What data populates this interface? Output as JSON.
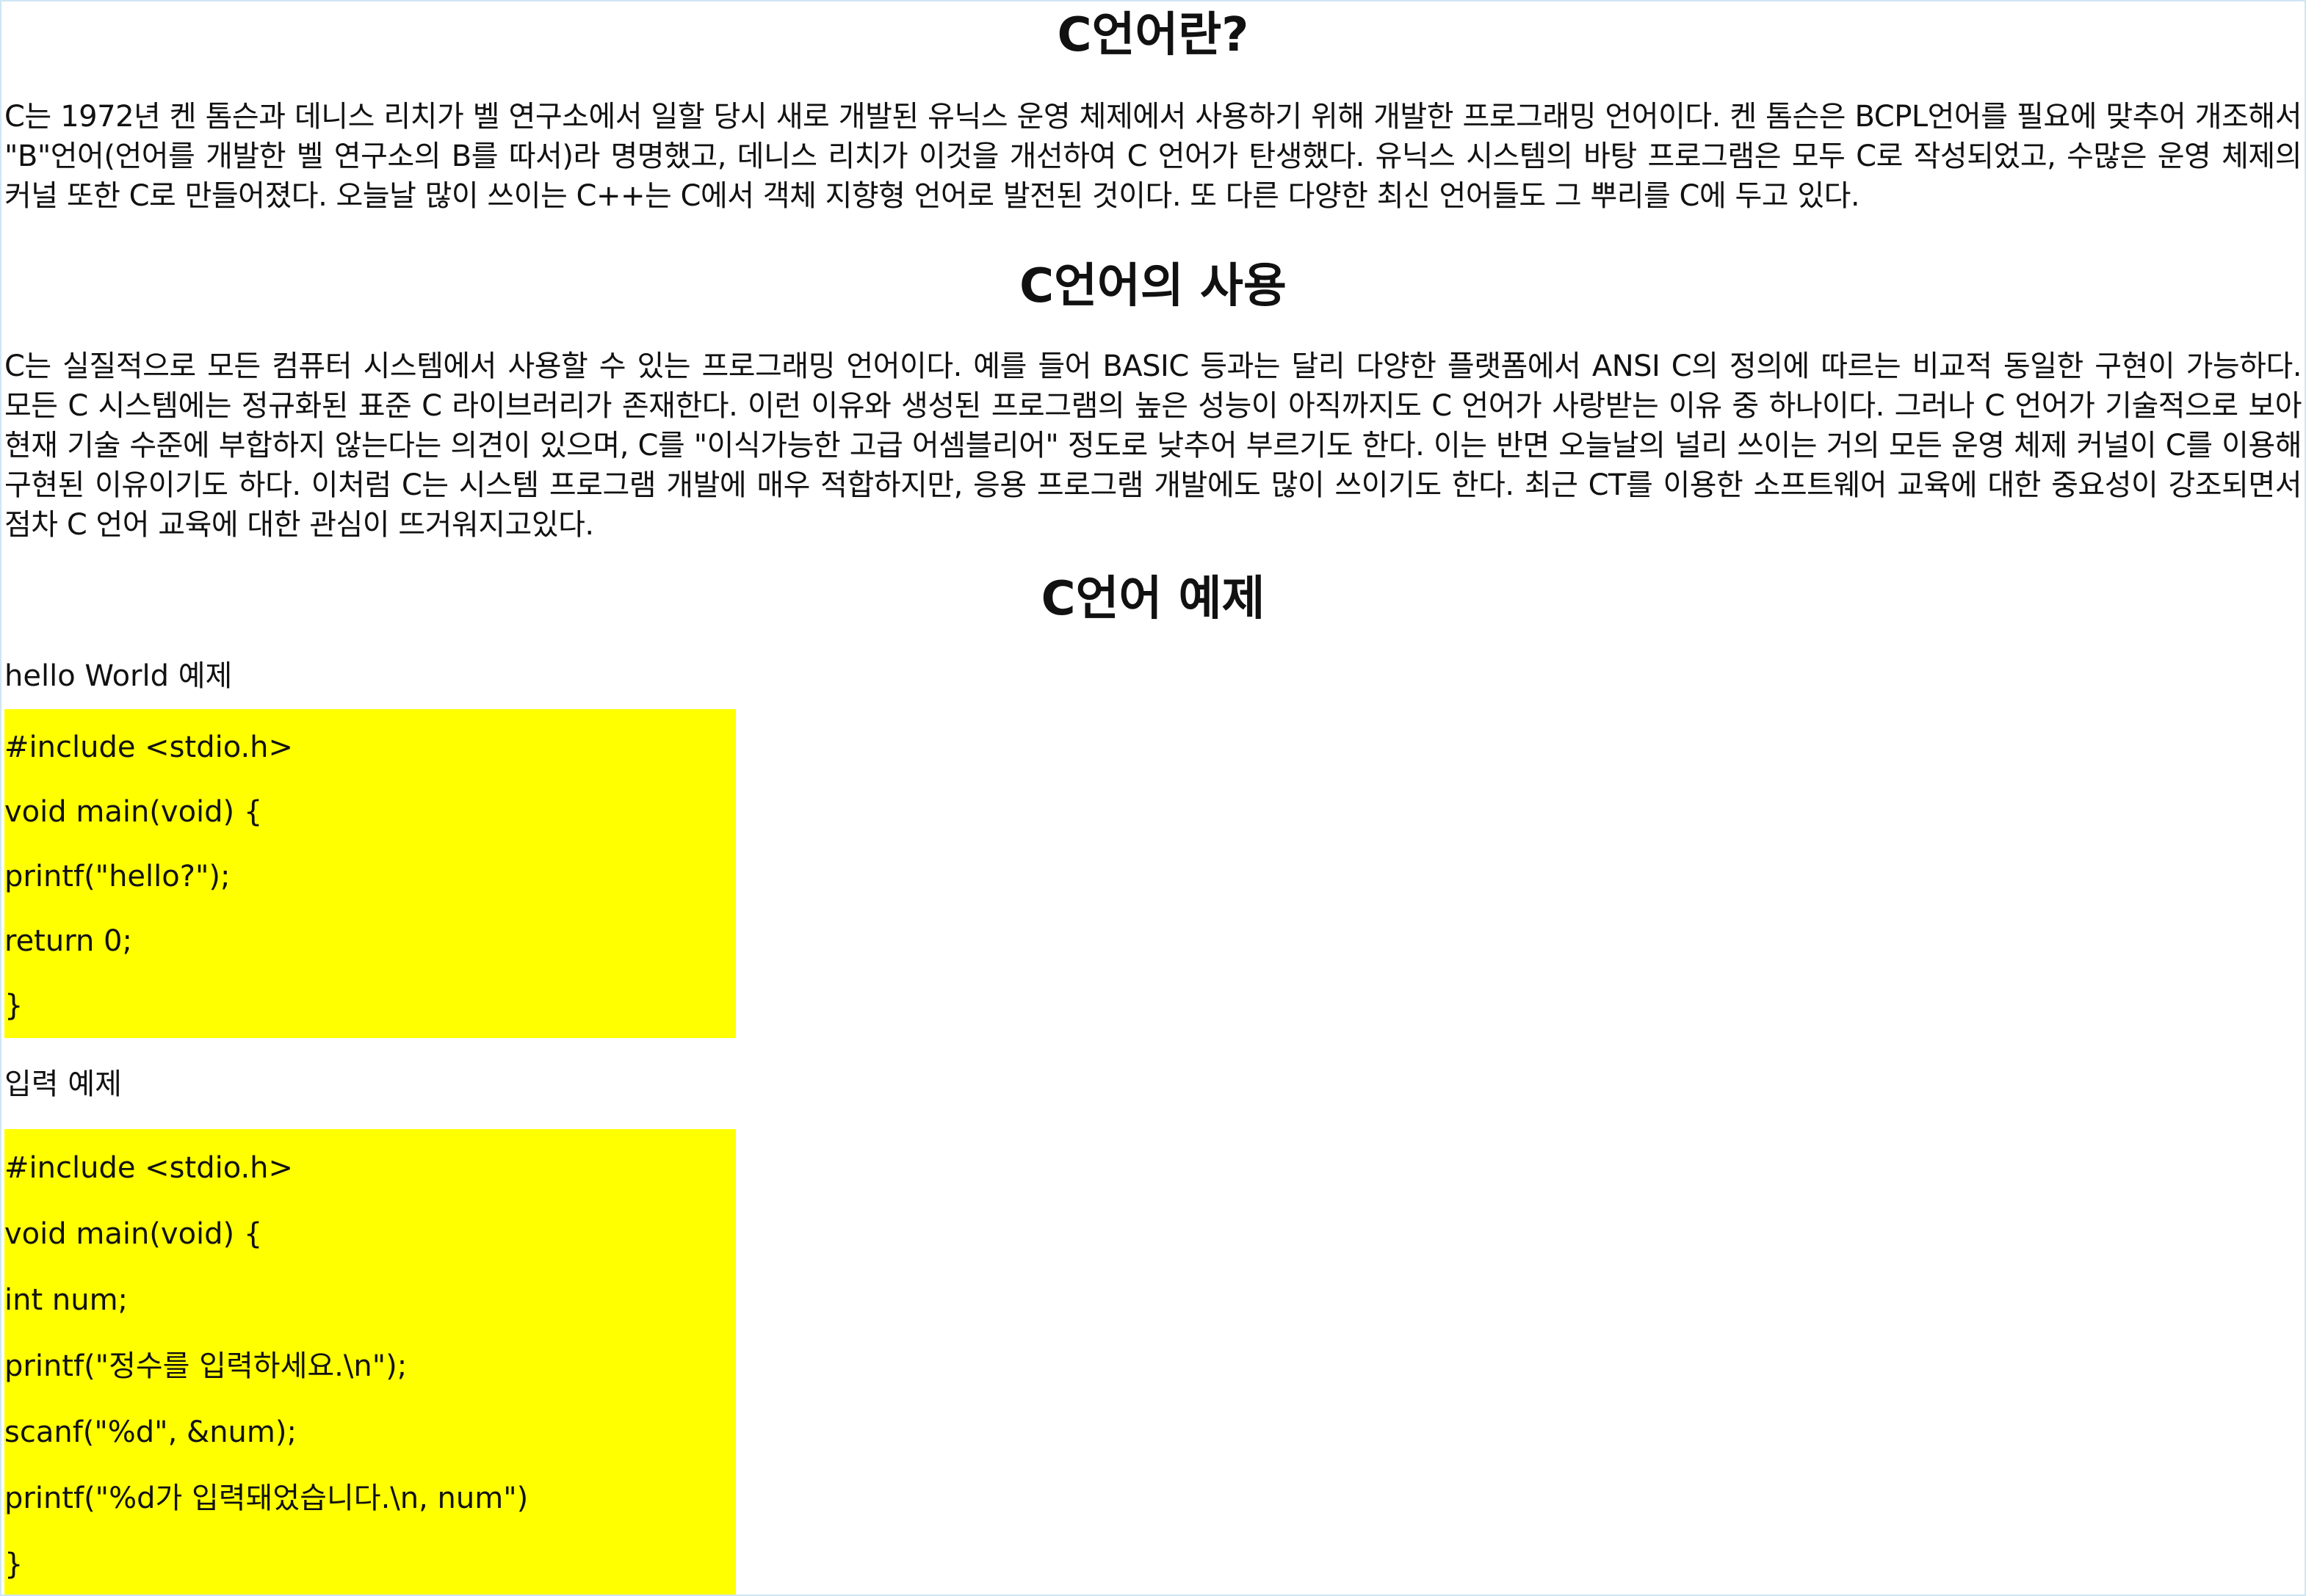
{
  "sections": {
    "intro": {
      "title": "C언어란?",
      "paragraph": "C는 1972년 켄 톰슨과 데니스 리치가 벨 연구소에서 일할 당시 새로 개발된 유닉스 운영 체제에서 사용하기 위해 개발한 프로그래밍 언어이다. 켄 톰슨은 BCPL언어를 필요에 맞추어 개조해서 \"B\"언어(언어를 개발한 벨 연구소의 B를 따서)라 명명했고, 데니스 리치가 이것을 개선하여 C 언어가 탄생했다. 유닉스 시스템의 바탕 프로그램은 모두 C로 작성되었고, 수많은 운영 체제의 커널 또한 C로 만들어졌다. 오늘날 많이 쓰이는 C++는 C에서 객체 지향형 언어로 발전된 것이다. 또 다른 다양한 최신 언어들도 그 뿌리를 C에 두고 있다."
    },
    "usage": {
      "title": "C언어의 사용",
      "paragraph": "C는 실질적으로 모든 컴퓨터 시스템에서 사용할 수 있는 프로그래밍 언어이다. 예를 들어 BASIC 등과는 달리 다양한 플랫폼에서 ANSI C의 정의에 따르는 비교적 동일한 구현이 가능하다. 모든 C 시스템에는 정규화된 표준 C 라이브러리가 존재한다. 이런 이유와 생성된 프로그램의 높은 성능이 아직까지도 C 언어가 사랑받는 이유 중 하나이다. 그러나 C 언어가 기술적으로 보아 현재 기술 수준에 부합하지 않는다는 의견이 있으며, C를 \"이식가능한 고급 어셈블리어\" 정도로 낮추어 부르기도 한다. 이는 반면 오늘날의 널리 쓰이는 거의 모든 운영 체제 커널이 C를 이용해 구현된 이유이기도 하다. 이처럼 C는 시스템 프로그램 개발에 매우 적합하지만, 응용 프로그램 개발에도 많이 쓰이기도 한다. 최근 CT를 이용한 소프트웨어 교육에 대한 중요성이 강조되면서 점차 C 언어 교육에 대한 관심이 뜨거워지고있다."
    },
    "examples": {
      "title": "C언어 예제",
      "hello": {
        "label": "hello World 예제",
        "lines": [
          "#include <stdio.h>",
          "void main(void) {",
          "printf(\"hello?\");",
          "return 0;",
          "}"
        ]
      },
      "input": {
        "label": "입력 예제",
        "lines": [
          "#include <stdio.h>",
          "void main(void) {",
          "int num;",
          "printf(\"정수를 입력하세요.\\n\");",
          "scanf(\"%d\", &num);",
          "printf(\"%d가 입력돼었습니다.\\n, num\")",
          "}"
        ]
      }
    }
  },
  "colors": {
    "code_background": "#ffff00",
    "page_border": "#cfe6f3"
  }
}
